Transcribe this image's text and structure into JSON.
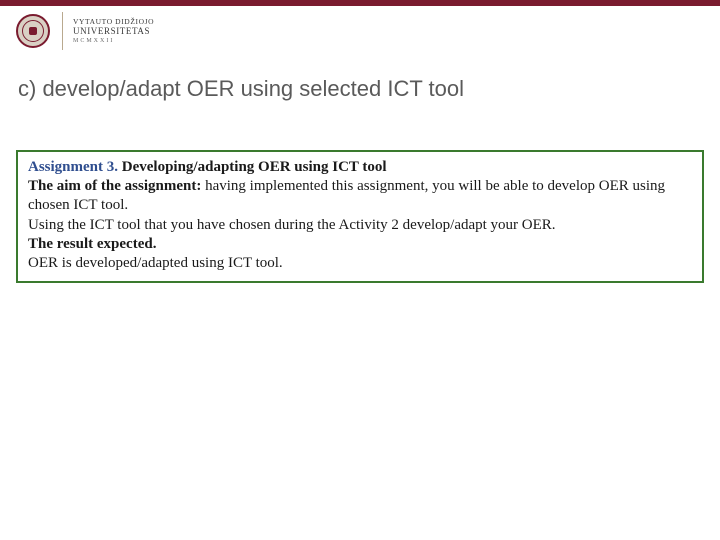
{
  "header": {
    "brand_line1": "Vytauto Didžiojo",
    "brand_line2": "Universitetas",
    "brand_year": "MCMXXII"
  },
  "slide": {
    "title": "c) develop/adapt OER using selected ICT tool"
  },
  "assignment": {
    "label": "Assignment 3.",
    "heading": " Developing/adapting OER using ICT tool",
    "aim_label": "The aim of the assignment:",
    "aim_text": " having implemented this assignment, you will be able to develop OER using chosen ICT tool.",
    "instruction": "Using the ICT tool that you have chosen during the Activity 2 develop/adapt your OER.",
    "result_label": "The result expected.",
    "result_text": "OER is developed/adapted using ICT tool."
  }
}
